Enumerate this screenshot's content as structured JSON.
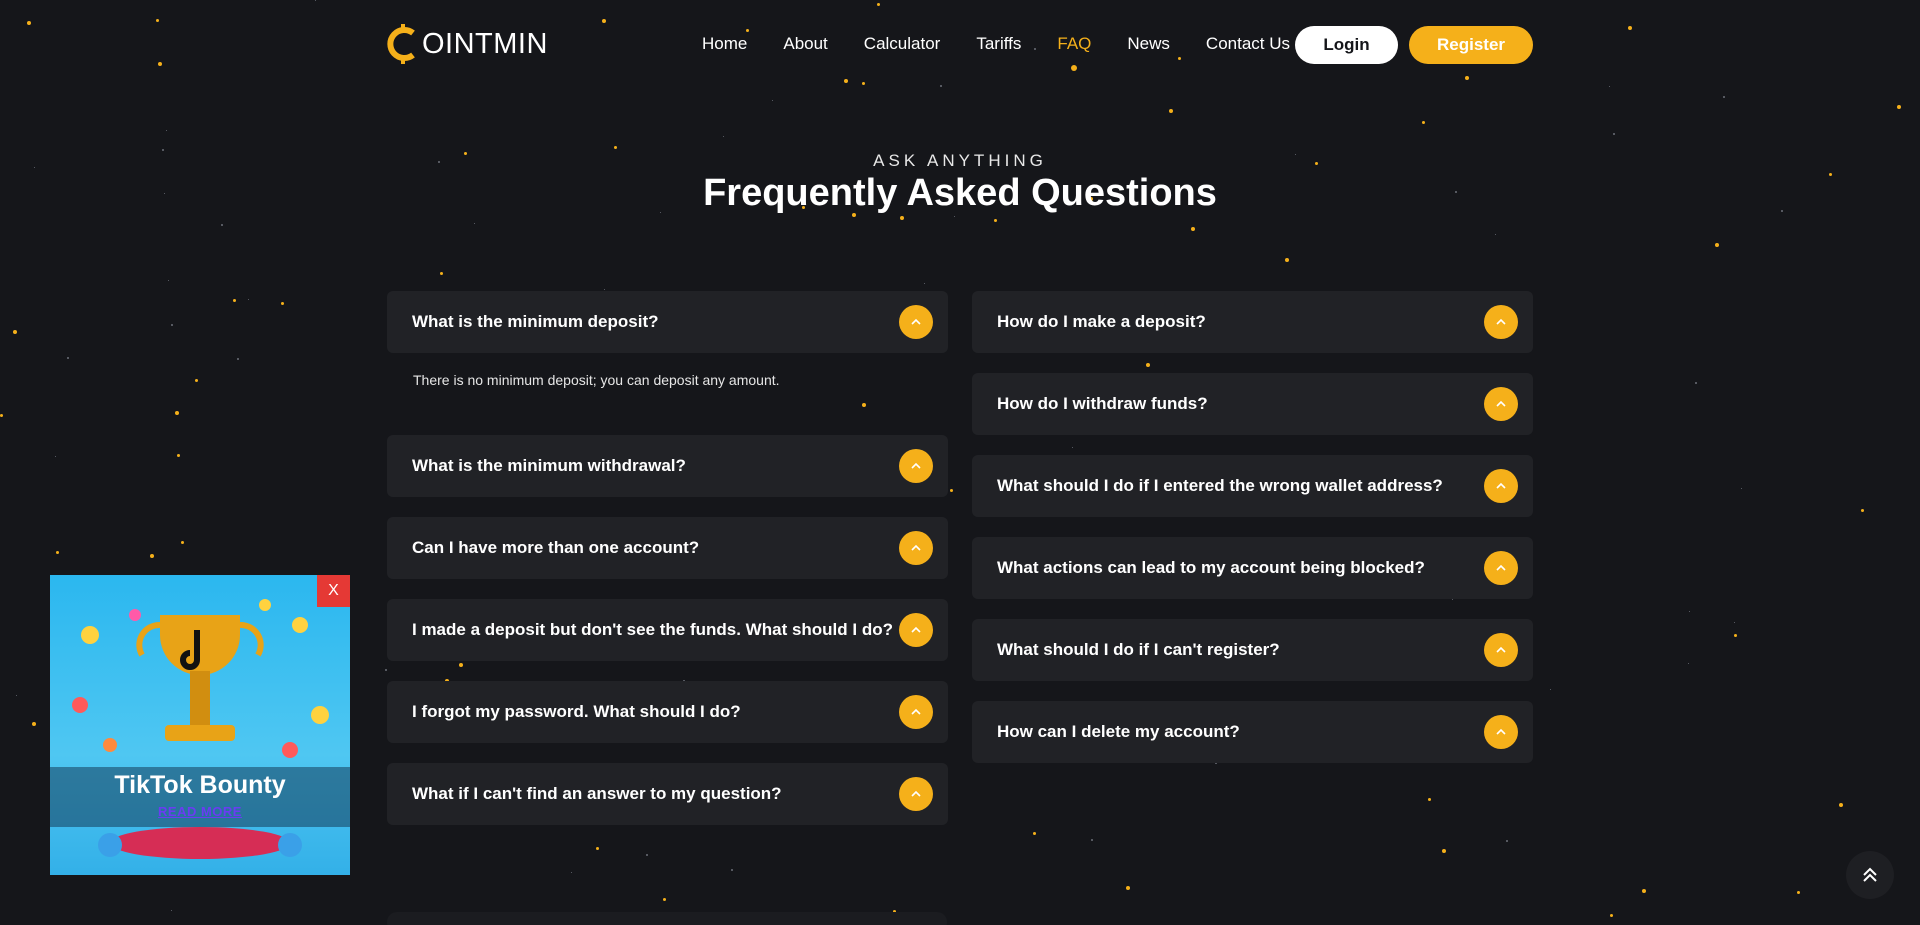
{
  "header": {
    "logo_text": "OINTMIN",
    "nav": [
      {
        "label": "Home",
        "active": false
      },
      {
        "label": "About",
        "active": false
      },
      {
        "label": "Calculator",
        "active": false
      },
      {
        "label": "Tariffs",
        "active": false
      },
      {
        "label": "FAQ",
        "active": true
      },
      {
        "label": "News",
        "active": false
      },
      {
        "label": "Contact Us",
        "active": false
      }
    ],
    "login_label": "Login",
    "register_label": "Register"
  },
  "hero": {
    "eyebrow": "ASK ANYTHING",
    "title": "Frequently Asked Questions"
  },
  "faq": {
    "left": [
      {
        "question": "What is the minimum deposit?",
        "open": true,
        "answer": "There is no minimum deposit; you can deposit any amount."
      },
      {
        "question": "What is the minimum withdrawal?",
        "open": false
      },
      {
        "question": "Can I have more than one account?",
        "open": false
      },
      {
        "question": "I made a deposit but don't see the funds. What should I do?",
        "open": false
      },
      {
        "question": "I forgot my password. What should I do?",
        "open": false
      },
      {
        "question": "What if I can't find an answer to my question?",
        "open": false
      }
    ],
    "right": [
      {
        "question": "How do I make a deposit?",
        "open": false
      },
      {
        "question": "How do I withdraw funds?",
        "open": false
      },
      {
        "question": "What should I do if I entered the wrong wallet address?",
        "open": false
      },
      {
        "question": "What actions can lead to my account being blocked?",
        "open": false
      },
      {
        "question": "What should I do if I can't register?",
        "open": false
      },
      {
        "question": "How can I delete my account?",
        "open": false
      }
    ]
  },
  "popup": {
    "close_label": "X",
    "title": "TikTok Bounty",
    "read_more": "READ MORE"
  },
  "colors": {
    "background": "#15161a",
    "card": "#212226",
    "accent": "#f5b01a",
    "close": "#e53935"
  },
  "icons": {
    "faq_toggle": "chevron-up-icon",
    "back_to_top": "double-chevron-up-icon",
    "logo": "coin-c-icon"
  }
}
